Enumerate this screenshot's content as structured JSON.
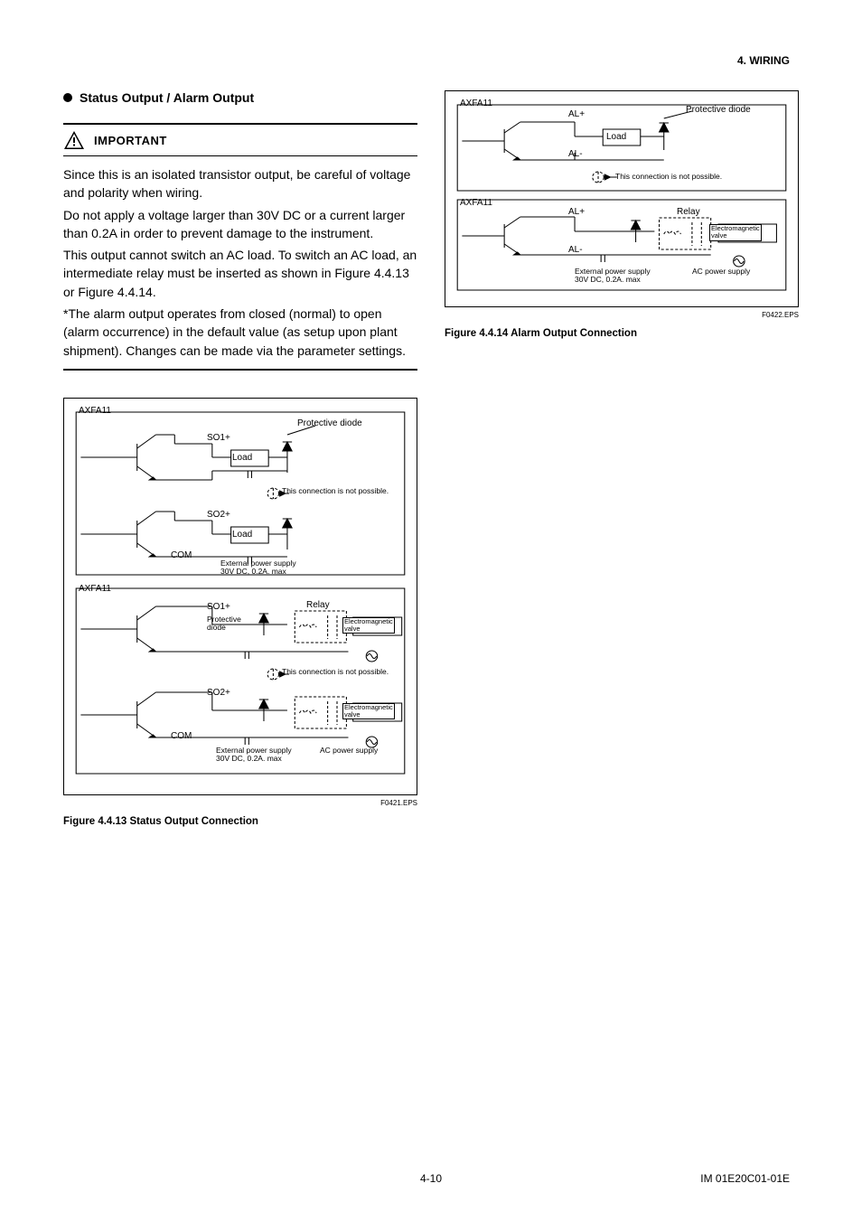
{
  "header": {
    "section": "4.  WIRING"
  },
  "left": {
    "section_title": "Status Output / Alarm Output",
    "important_label": "IMPORTANT",
    "p1": "Since this is an isolated transistor output, be careful of voltage and polarity when wiring.",
    "p2": "Do not apply a voltage larger than 30V DC or a current larger than 0.2A in order to prevent damage to the instrument.",
    "p3": "This output cannot switch an AC load. To switch an AC load, an intermediate relay must be inserted as shown in Figure 4.4.13 or Figure 4.4.14.",
    "p4": "*The alarm output operates from closed (normal) to open (alarm occurrence) in the default value (as setup upon plant shipment).  Changes can be made via the parameter settings."
  },
  "fig13": {
    "caption": "Figure 4.4.13  Status Output Connection",
    "eps": "F0421.EPS",
    "axfa": "AXFA11",
    "so1": "SO1+",
    "so2": "SO2+",
    "com": "COM",
    "load": "Load",
    "prot_diode": "Protective diode",
    "prot_diode_short": "Protective\ndiode",
    "not_possible": "This connection is not possible.",
    "ext_supply": "External power supply\n30V DC, 0.2A. max",
    "relay": "Relay",
    "em_valve": "Electromagnetic\nvalve",
    "ac_supply": "AC power supply"
  },
  "fig14": {
    "caption": "Figure 4.4.14  Alarm Output Connection",
    "eps": "F0422.EPS",
    "axfa": "AXFA11",
    "al_plus": "AL+",
    "al_minus": "AL-",
    "load": "Load",
    "prot_diode": "Protective diode",
    "not_possible": "This connection is not possible.",
    "ext_supply": "External power supply\n30V DC, 0.2A. max",
    "relay": "Relay",
    "em_valve": "Electromagnetic\nvalve",
    "ac_supply": "AC power supply"
  },
  "footer": {
    "page": "4-10",
    "doc": "IM 01E20C01-01E"
  }
}
